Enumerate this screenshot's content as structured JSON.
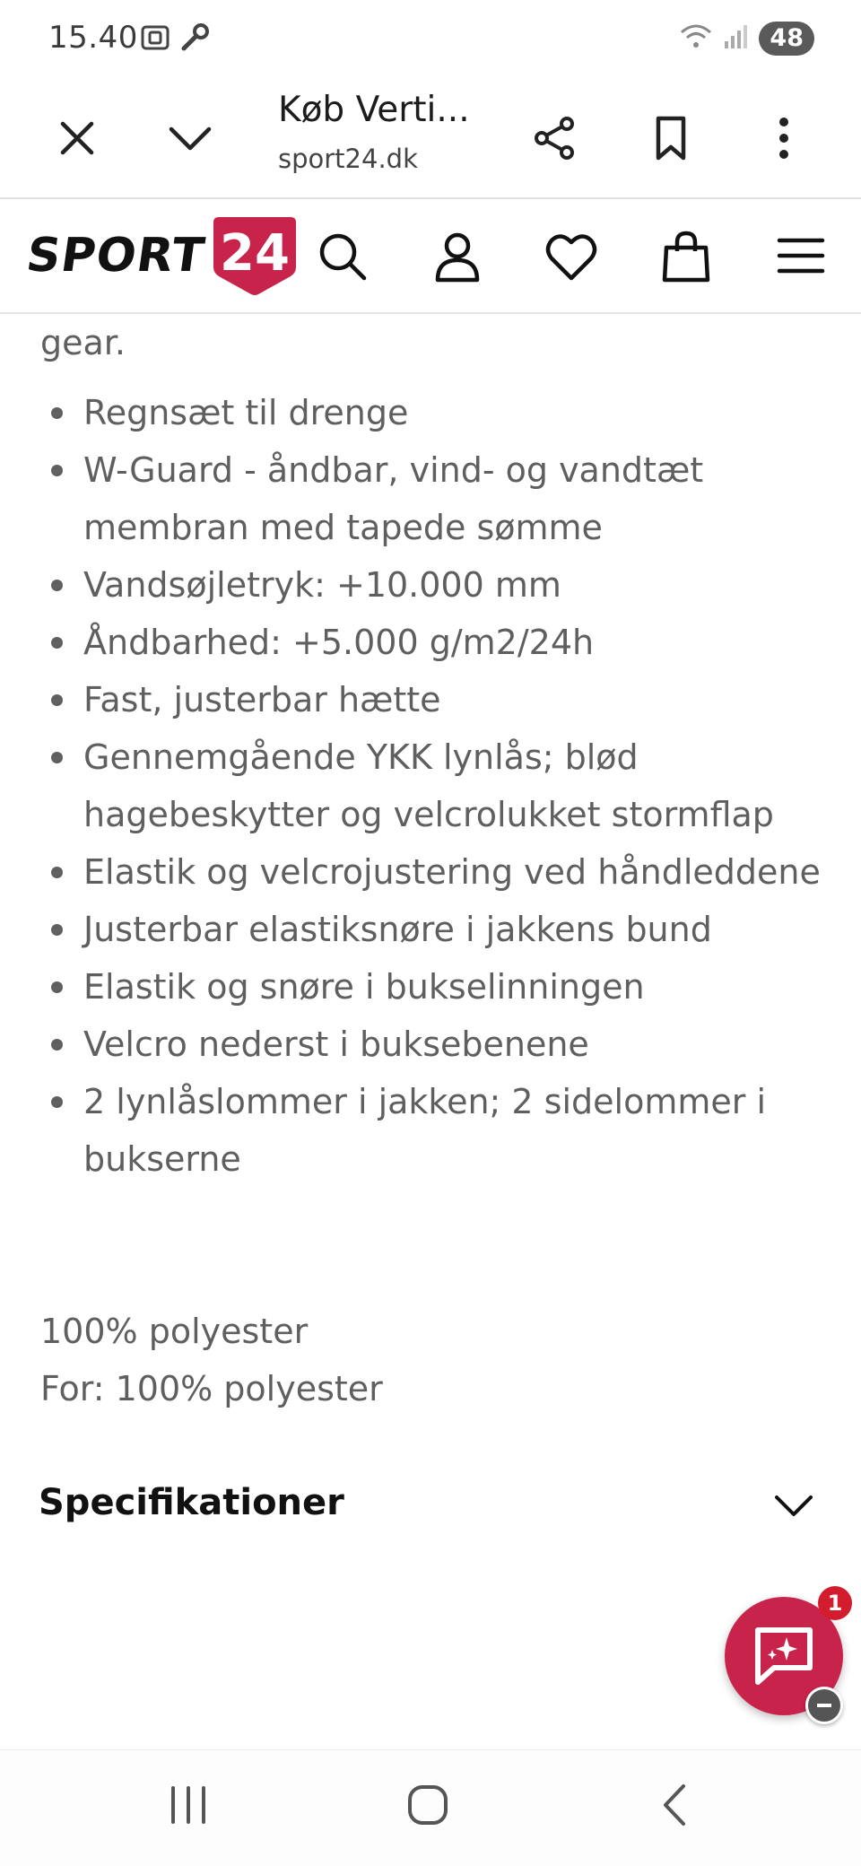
{
  "status_bar": {
    "time": "15.40",
    "battery": "48"
  },
  "tab": {
    "title": "Køb Verti...",
    "url": "sport24.dk"
  },
  "site": {
    "logo_text": "SPORT",
    "logo_number": "24",
    "brand_color": "#c8234a"
  },
  "content": {
    "cut_text": "gear.",
    "features": [
      "Regnsæt til drenge",
      "W-Guard - åndbar, vind- og vandtæt membran med tapede sømme",
      "Vandsøjletryk: +10.000 mm",
      "Åndbarhed: +5.000 g/m2/24h",
      "Fast, justerbar hætte",
      "Gennemgående YKK lynlås; blød hagebeskytter og velcrolukket stormflap",
      "Elastik og velcrojustering ved håndleddene",
      "Justerbar elastiksnøre i jakkens bund",
      "Elastik og snøre i bukselinningen",
      "Velcro nederst i buksebenene",
      "2 lynlåslommer i jakken; 2 sidelommer i bukserne"
    ],
    "material_1": "100% polyester",
    "material_2": "For: 100% polyester",
    "specs_title": "Specifikationer"
  },
  "chat": {
    "badge_count": "1"
  }
}
